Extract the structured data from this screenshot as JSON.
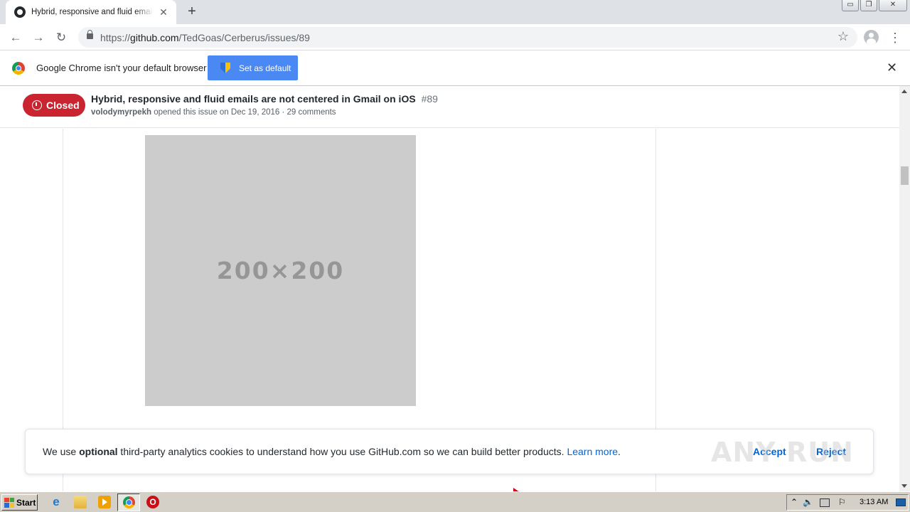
{
  "browser": {
    "tab_title": "Hybrid, responsive and fluid emails are not centered in Gmail on iOS",
    "tab_close": "✕",
    "new_tab": "+",
    "url_prefix": "https://",
    "url_host": "github.com",
    "url_path": "/TedGoas/Cerberus/issues/89",
    "back": "←",
    "forward": "→",
    "reload": "↻",
    "star": "☆",
    "menu": "⋮"
  },
  "window_controls": {
    "minimize": "▭",
    "restore": "❐",
    "close": "✕"
  },
  "infobar": {
    "message": "Google Chrome isn't your default browser",
    "button_label": "Set as default",
    "close": "✕"
  },
  "issue": {
    "state": "Closed",
    "title": "Hybrid, responsive and fluid emails are not centered in Gmail on iOS",
    "number": "#89",
    "author": "volodymyrpekh",
    "meta": "opened this issue on Dec 19, 2016 · 29 comments",
    "state_color": "#cb2431"
  },
  "content": {
    "placeholder_text": "200×200"
  },
  "cookie_banner": {
    "text_before": "We use ",
    "text_bold": "optional",
    "text_after": " third-party analytics cookies to understand how you use GitHub.com so we can build better products. ",
    "learn_more": "Learn more",
    "period": ".",
    "accept": "Accept",
    "reject": "Reject"
  },
  "watermark": "ANY RUN",
  "taskbar": {
    "start_label": "Start",
    "ie_glyph": "e",
    "opera_glyph": "O",
    "tray_arrow": "⌃",
    "volume_glyph": "🔈",
    "flag_glyph": "⚐",
    "clock": "3:13 AM"
  },
  "icons": {
    "github": "github-icon",
    "chrome": "chrome-icon",
    "shield": "uac-shield-icon",
    "lock": "lock-icon"
  }
}
